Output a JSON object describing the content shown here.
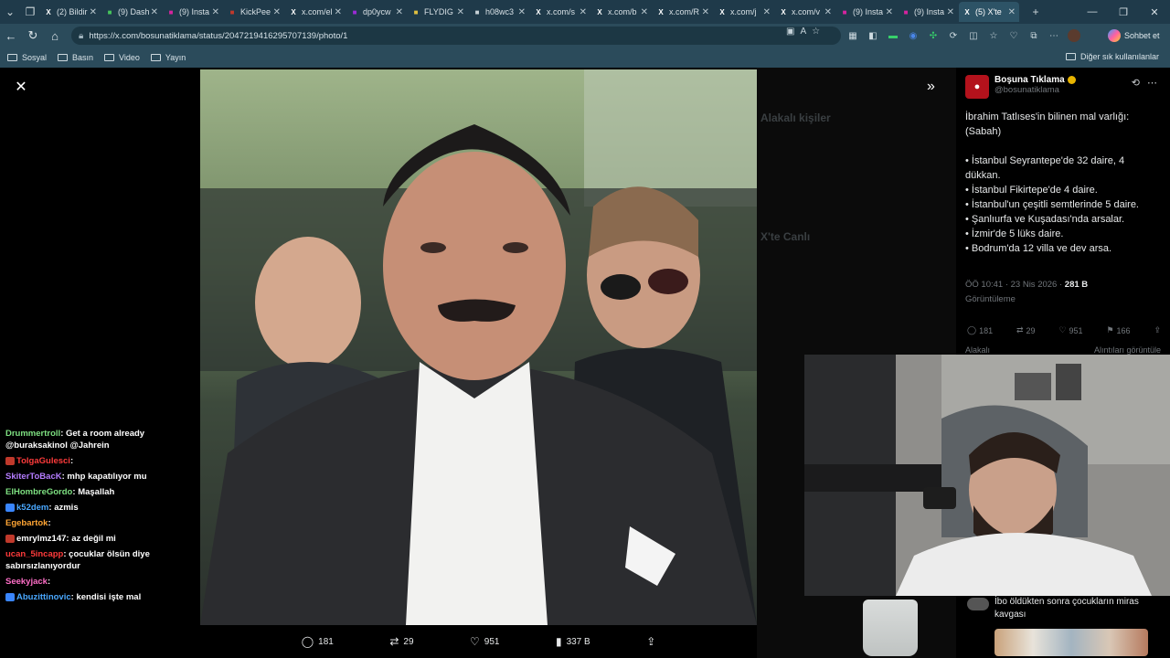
{
  "browser": {
    "tabs": [
      {
        "label": "(2) Bildir",
        "favicon": "x-icon",
        "color": "#ffffff",
        "active": false
      },
      {
        "label": "(9) Dash",
        "favicon": "doc-icon",
        "color": "#46c35b",
        "active": false
      },
      {
        "label": "(9) Insta",
        "favicon": "instagram-icon",
        "color": "#d6249f",
        "active": false
      },
      {
        "label": "KickPee",
        "favicon": "kick-icon",
        "color": "#c0392b",
        "active": false
      },
      {
        "label": "x.com/el",
        "favicon": "x-icon",
        "color": "#ffffff",
        "active": false
      },
      {
        "label": "dp0ycw",
        "favicon": "app-icon",
        "color": "#9b2bd6",
        "active": false
      },
      {
        "label": "FLYDIG",
        "favicon": "fly-icon",
        "color": "#e0c040",
        "active": false
      },
      {
        "label": "h08wc3",
        "favicon": "globe-icon",
        "color": "#c7d1d6",
        "active": false
      },
      {
        "label": "x.com/s",
        "favicon": "x-icon",
        "color": "#ffffff",
        "active": false
      },
      {
        "label": "x.com/b",
        "favicon": "x-icon",
        "color": "#ffffff",
        "active": false
      },
      {
        "label": "x.com/R",
        "favicon": "x-icon",
        "color": "#ffffff",
        "active": false
      },
      {
        "label": "x.com/j",
        "favicon": "x-icon",
        "color": "#ffffff",
        "active": false
      },
      {
        "label": "x.com/v",
        "favicon": "x-icon",
        "color": "#ffffff",
        "active": false
      },
      {
        "label": "(9) Insta",
        "favicon": "instagram-icon",
        "color": "#d6249f",
        "active": false
      },
      {
        "label": "(9) Insta",
        "favicon": "instagram-icon",
        "color": "#d6249f",
        "active": false
      },
      {
        "label": "(5) X'te",
        "favicon": "x-icon",
        "color": "#ffffff",
        "active": true
      }
    ],
    "url": "https://x.com/bosunatiklama/status/2047219416295707139/photo/1",
    "copilot_label": "Sohbet et",
    "bookmarks": [
      "Sosyal",
      "Basın",
      "Video",
      "Yayın"
    ],
    "bookmarks_other": "Diğer sık kullanılanlar"
  },
  "viewer": {
    "actions": {
      "replies": "181",
      "reposts": "29",
      "likes": "951",
      "views": "337 B"
    }
  },
  "background_panel": {
    "faded_heading_1": "Alakalı kişiler",
    "faded_heading_2": "X'te Canlı"
  },
  "tweet": {
    "author_name": "Boşuna Tıklama",
    "author_handle": "@bosunatiklama",
    "intro": "İbrahim Tatlıses'in bilinen mal varlığı: (Sabah)",
    "items": [
      "• İstanbul Seyrantepe'de 32 daire, 4 dükkan.",
      "• İstanbul Fikirtepe'de 4 daire.",
      "• İstanbul'un çeşitli semtlerinde 5 daire.",
      "• Şanlıurfa ve Kuşadası'nda arsalar.",
      "• İzmir'de 5 lüks daire.",
      "• Bodrum'da 12 villa ve dev arsa."
    ],
    "timestamp": "ÖÖ 10:41 · 23 Nis 2026 · ",
    "view_count": "281 B",
    "views_label": "Görüntüleme",
    "stats": {
      "replies": "181",
      "reposts": "29",
      "likes": "951",
      "bookmarks": "166"
    },
    "tab_left": "Alakalı",
    "tab_right": "Alıntıları görüntüle"
  },
  "chat": [
    {
      "user": "Drummertroll",
      "color": "#7ee081",
      "text": "Get a room already @buraksakinol @Jahrein",
      "badge": ""
    },
    {
      "user": "TolgaGulesci",
      "color": "#ff3b3b",
      "text": "",
      "badge": "#c0392b"
    },
    {
      "user": "SkiterToBacK",
      "color": "#b57cff",
      "text": "mhp kapatılıyor mu",
      "badge": ""
    },
    {
      "user": "ElHombreGordo",
      "color": "#7ee081",
      "text": "Maşallah",
      "badge": ""
    },
    {
      "user": "k52dem",
      "color": "#4aa8ff",
      "text": "azmis",
      "badge": "#3a86ff"
    },
    {
      "user": "Egebartok",
      "color": "#ffa534",
      "text": "",
      "badge": ""
    },
    {
      "user": "emrylmz147",
      "color": "#ffffff",
      "text": "az değil mi",
      "badge": "#c0392b"
    },
    {
      "user": "ucan_5incapp",
      "color": "#ff3b3b",
      "text": "çocuklar ölsün diye sabırsızlanıyordur",
      "badge": ""
    },
    {
      "user": "Seekyjack",
      "color": "#ff6ec7",
      "text": "",
      "badge": ""
    },
    {
      "user": "Abuzittinovic",
      "color": "#4aa8ff",
      "text": "kendisi işte mal",
      "badge": "#3a86ff"
    }
  ],
  "related": {
    "title": "İbo öldükten sonra çocukların miras kavgası"
  }
}
